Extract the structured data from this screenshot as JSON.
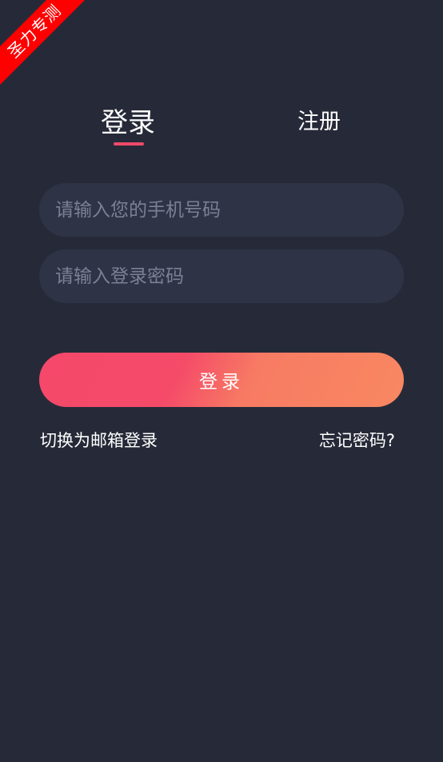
{
  "ribbon": {
    "text": "圣力专测",
    "color": "#ff0000"
  },
  "tabs": {
    "login": "登录",
    "register": "注册",
    "active": "login",
    "indicator_color": "#f04a6a"
  },
  "form": {
    "phone_placeholder": "请输入您的手机号码",
    "phone_value": "",
    "password_placeholder": "请输入登录密码",
    "password_value": ""
  },
  "login_button": {
    "label": "登录",
    "gradient_start": "#f5486a",
    "gradient_end": "#f88862"
  },
  "links": {
    "switch_email": "切换为邮箱登录",
    "forgot_password": "忘记密码?"
  },
  "colors": {
    "background": "#262a38",
    "field_background": "#2e3346"
  }
}
